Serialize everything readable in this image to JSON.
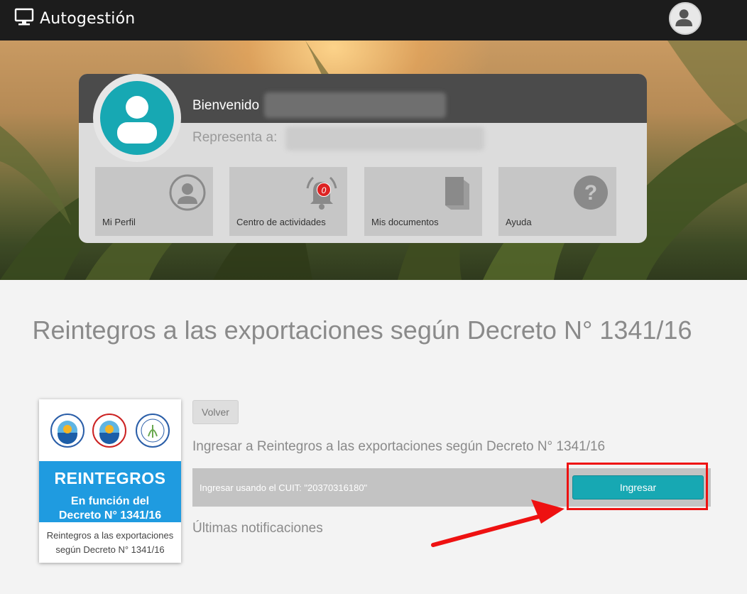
{
  "header": {
    "title": "Autogestión",
    "brand_icon": "monitor-icon",
    "user_icon": "user-icon"
  },
  "welcome": {
    "greeting": "Bienvenido",
    "represents_label": "Representa a:",
    "tiles": [
      {
        "label": "Mi Perfil",
        "icon": "profile-icon"
      },
      {
        "label": "Centro de actividades",
        "icon": "bell-icon",
        "badge": "0"
      },
      {
        "label": "Mis documentos",
        "icon": "book-icon"
      },
      {
        "label": "Ayuda",
        "icon": "help-icon"
      }
    ]
  },
  "main": {
    "title": "Reintegros a las exportaciones según Decreto N° 1341/16",
    "back_label": "Volver",
    "section_title": "Ingresar a Reintegros a las exportaciones según Decreto N° 1341/16",
    "cuit_text": "Ingresar usando el CUIT: \"20370316180\"",
    "enter_label": "Ingresar",
    "notifications_title": "Últimas notificaciones"
  },
  "promo": {
    "heading": "REINTEGROS",
    "sub_line1": "En función del",
    "sub_line2": "Decreto N° 1341/16",
    "caption_line1": "Reintegros a las exportaciones",
    "caption_line2": "según Decreto N° 1341/16"
  },
  "colors": {
    "accent": "#17a8b3",
    "topbar": "#1c1c1c",
    "promo_blue": "#1f9be0",
    "highlight": "#e11111"
  }
}
